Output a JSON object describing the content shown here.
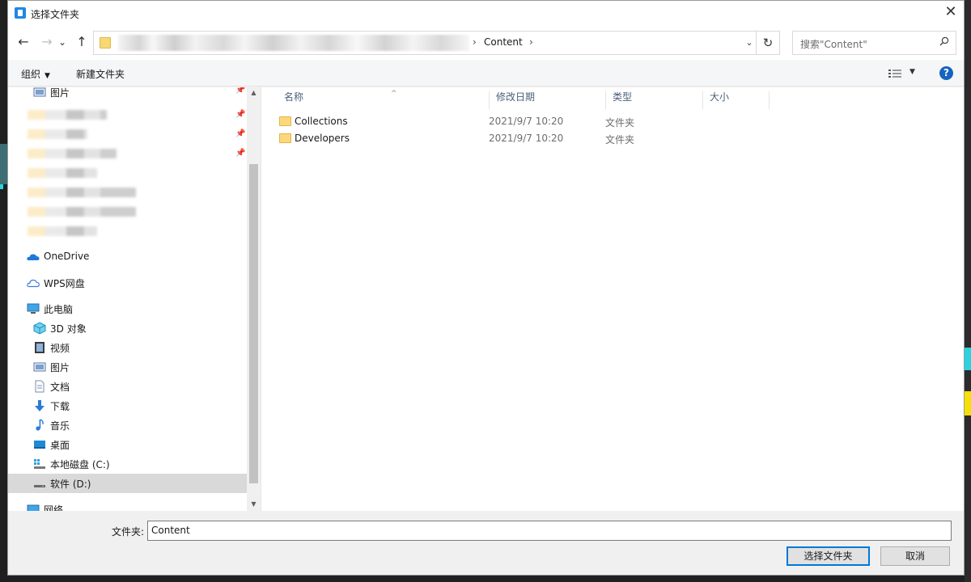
{
  "dialog": {
    "title": "选择文件夹",
    "close_glyph": "✕"
  },
  "nav": {
    "back_glyph": "←",
    "forward_glyph": "→",
    "recent_glyph": "⌄",
    "up_glyph": "↑",
    "breadcrumb_current": "Content",
    "dropdown_glyph": "⌄",
    "refresh_glyph": "↻",
    "search_placeholder": "搜索\"Content\""
  },
  "toolbar": {
    "organize_label": "组织",
    "new_folder_label": "新建文件夹",
    "help_glyph": "?"
  },
  "sidebar": {
    "quick_access_partial_label": "图片",
    "items": [
      {
        "label": "OneDrive",
        "icon": "onedrive-icon"
      },
      {
        "label": "WPS网盘",
        "icon": "wps-cloud-icon"
      },
      {
        "label": "此电脑",
        "icon": "computer-icon"
      },
      {
        "label": "3D 对象",
        "icon": "3d-objects-icon"
      },
      {
        "label": "视频",
        "icon": "video-icon"
      },
      {
        "label": "图片",
        "icon": "pictures-icon"
      },
      {
        "label": "文档",
        "icon": "documents-icon"
      },
      {
        "label": "下载",
        "icon": "download-icon"
      },
      {
        "label": "音乐",
        "icon": "music-icon"
      },
      {
        "label": "桌面",
        "icon": "desktop-icon"
      },
      {
        "label": "本地磁盘 (C:)",
        "icon": "drive-c-icon"
      },
      {
        "label": "软件 (D:)",
        "icon": "drive-d-icon",
        "selected": true
      },
      {
        "label": "网络",
        "icon": "network-icon"
      }
    ]
  },
  "filelist": {
    "columns": [
      "名称",
      "修改日期",
      "类型",
      "大小"
    ],
    "rows": [
      {
        "name": "Collections",
        "date": "2021/9/7 10:20",
        "type": "文件夹"
      },
      {
        "name": "Developers",
        "date": "2021/9/7 10:20",
        "type": "文件夹"
      }
    ]
  },
  "footer": {
    "folder_label": "文件夹:",
    "folder_value": "Content",
    "select_button": "选择文件夹",
    "cancel_button": "取消"
  },
  "colors": {
    "accent": "#0078d7",
    "help_blue": "#1565c0",
    "folder_yellow": "#fcd87a",
    "selected_bg": "#d9d9d9"
  }
}
